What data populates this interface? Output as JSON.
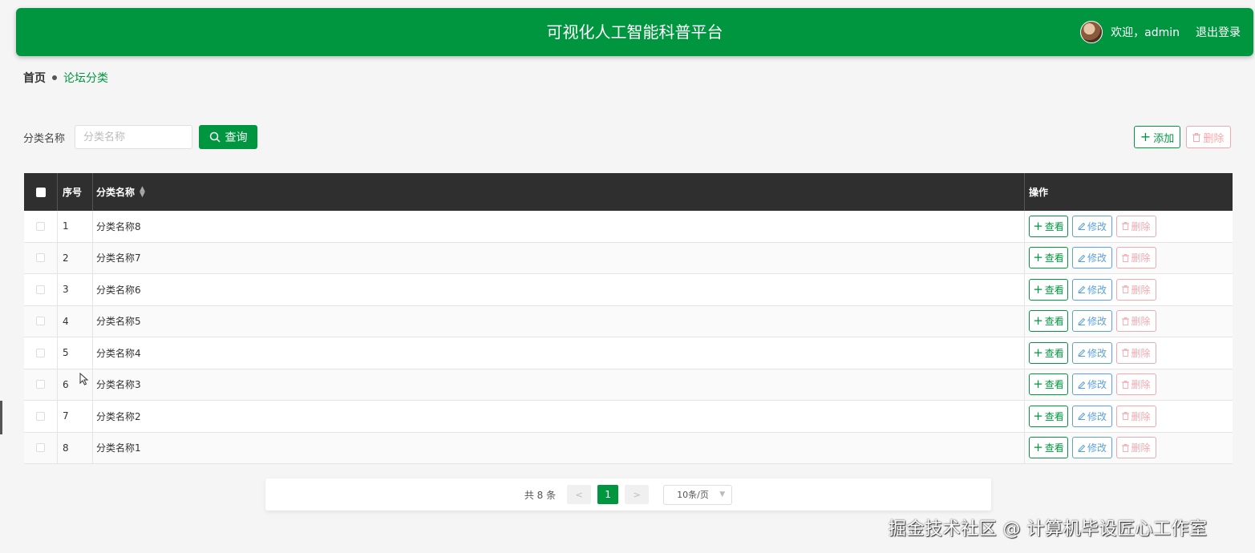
{
  "header": {
    "title": "可视化人工智能科普平台",
    "welcome": "欢迎，admin",
    "logout": "退出登录"
  },
  "breadcrumb": {
    "home": "首页",
    "current": "论坛分类"
  },
  "search": {
    "label": "分类名称",
    "placeholder": "分类名称",
    "query_label": "查询"
  },
  "toolbar": {
    "add_label": "添加",
    "delete_label": "删除"
  },
  "table": {
    "headers": {
      "index": "序号",
      "name": "分类名称",
      "ops": "操作"
    },
    "rows": [
      {
        "index": "1",
        "name": "分类名称8"
      },
      {
        "index": "2",
        "name": "分类名称7"
      },
      {
        "index": "3",
        "name": "分类名称6"
      },
      {
        "index": "4",
        "name": "分类名称5"
      },
      {
        "index": "5",
        "name": "分类名称4"
      },
      {
        "index": "6",
        "name": "分类名称3"
      },
      {
        "index": "7",
        "name": "分类名称2"
      },
      {
        "index": "8",
        "name": "分类名称1"
      }
    ],
    "row_actions": {
      "view": "查看",
      "edit": "修改",
      "delete": "删除"
    }
  },
  "pagination": {
    "total": "共 8 条",
    "prev": "<",
    "current": "1",
    "next": ">",
    "page_size": "10条/页"
  },
  "watermark": "掘金技术社区 @ 计算机毕设匠心工作室",
  "colors": {
    "primary": "#00963f",
    "edit": "#5ba1e0",
    "danger": "#f1a8ae",
    "table_header": "#2f2f2f"
  }
}
